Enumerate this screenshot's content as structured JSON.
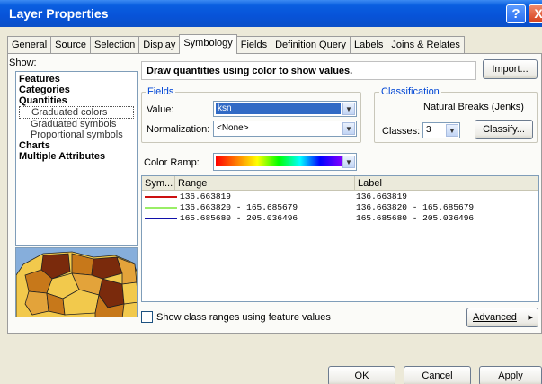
{
  "window": {
    "title": "Layer Properties",
    "help_glyph": "?",
    "close_glyph": "X"
  },
  "tabs": [
    {
      "label": "General"
    },
    {
      "label": "Source"
    },
    {
      "label": "Selection"
    },
    {
      "label": "Display"
    },
    {
      "label": "Symbology",
      "active": true
    },
    {
      "label": "Fields"
    },
    {
      "label": "Definition Query"
    },
    {
      "label": "Labels"
    },
    {
      "label": "Joins & Relates"
    }
  ],
  "show": {
    "label": "Show:",
    "items": [
      {
        "label": "Features",
        "kind": "cat"
      },
      {
        "label": "Categories",
        "kind": "cat"
      },
      {
        "label": "Quantities",
        "kind": "cat"
      },
      {
        "label": "Graduated colors",
        "kind": "sub",
        "selected": true
      },
      {
        "label": "Graduated symbols",
        "kind": "sub"
      },
      {
        "label": "Proportional symbols",
        "kind": "sub"
      },
      {
        "label": "Charts",
        "kind": "cat"
      },
      {
        "label": "Multiple Attributes",
        "kind": "cat"
      }
    ]
  },
  "description": "Draw quantities using color to show values.",
  "import_label": "Import...",
  "fields": {
    "group_label": "Fields",
    "value_label": "Value:",
    "value": "ksn",
    "normalization_label": "Normalization:",
    "normalization": "<None>"
  },
  "classification": {
    "group_label": "Classification",
    "method": "Natural Breaks (Jenks)",
    "classes_label": "Classes:",
    "classes": "3",
    "classify_label": "Classify..."
  },
  "color_ramp_label": "Color Ramp:",
  "table": {
    "headers": [
      "Sym...",
      "Range",
      "Label"
    ],
    "rows": [
      {
        "color": "#cc1010",
        "range": "136.663819",
        "label": "136.663819"
      },
      {
        "color": "#99ee66",
        "range": "136.663820 - 165.685679",
        "label": "136.663820 - 165.685679"
      },
      {
        "color": "#1010aa",
        "range": "165.685680 - 205.036496",
        "label": "165.685680 - 205.036496"
      }
    ]
  },
  "show_class_ranges_label": "Show class ranges using feature values",
  "advanced_label": "Advanced",
  "advanced_arrow": "▸",
  "buttons": {
    "ok": "OK",
    "cancel": "Cancel",
    "apply": "Apply"
  },
  "arrow_glyph": "▼"
}
